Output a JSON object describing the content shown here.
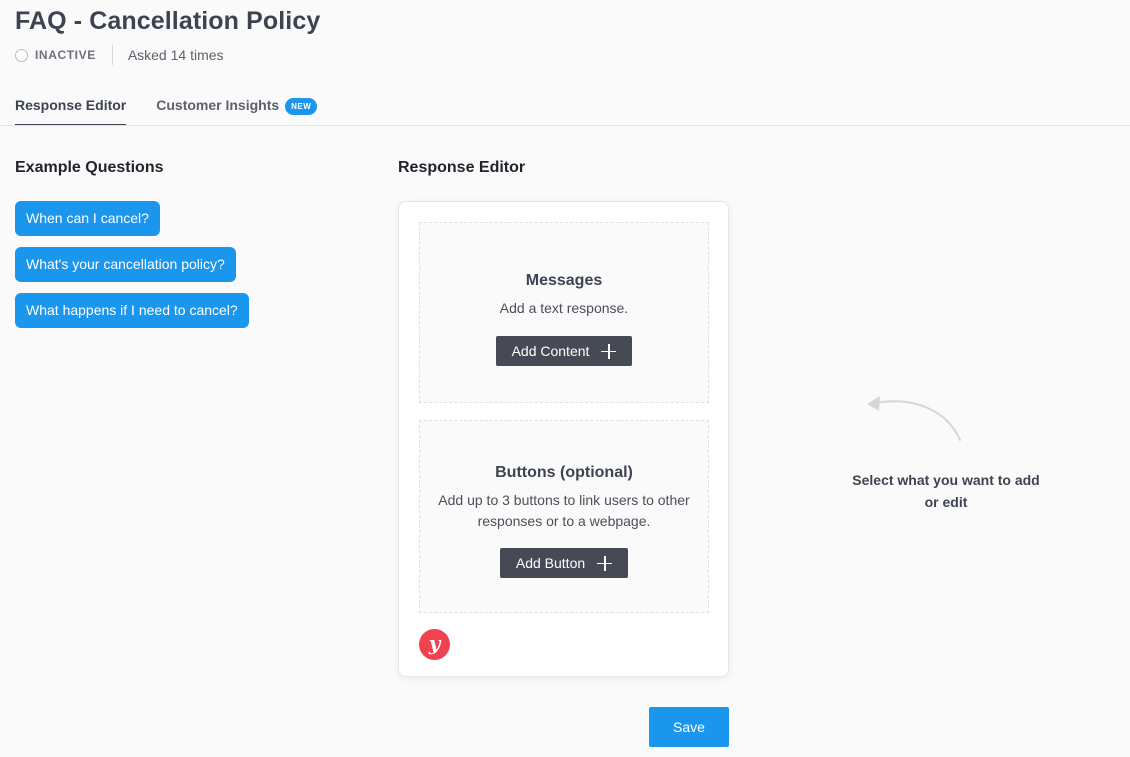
{
  "header": {
    "title": "FAQ - Cancellation Policy",
    "status": "INACTIVE",
    "asked": "Asked 14 times"
  },
  "tabs": [
    {
      "label": "Response Editor",
      "active": true
    },
    {
      "label": "Customer Insights",
      "badge": "NEW",
      "active": false
    }
  ],
  "examples": {
    "heading": "Example Questions",
    "questions": [
      "When can I cancel?",
      "What's your cancellation policy?",
      "What happens if I need to cancel?"
    ]
  },
  "editor": {
    "heading": "Response Editor",
    "messages": {
      "title": "Messages",
      "description": "Add a text response.",
      "button_label": "Add Content"
    },
    "buttons": {
      "title": "Buttons (optional)",
      "description": "Add up to 3 buttons to link users to other responses or to a webpage.",
      "button_label": "Add Button"
    },
    "logo_letter": "y"
  },
  "hint": {
    "text": "Select what you want to add or edit"
  },
  "actions": {
    "save_label": "Save"
  },
  "colors": {
    "accent": "#1a96ec",
    "dark_button": "#454a54",
    "logo": "#f1434f"
  }
}
